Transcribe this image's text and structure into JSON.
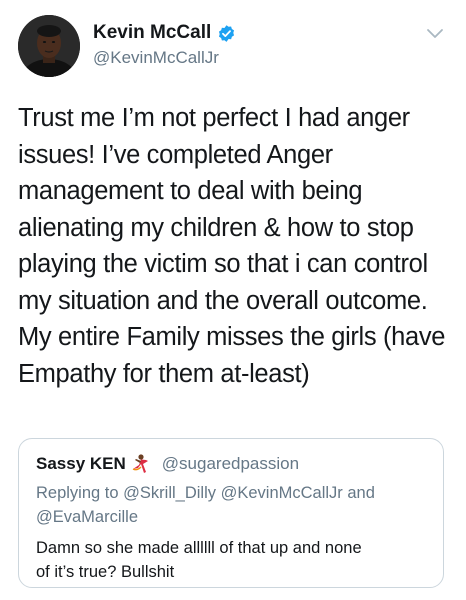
{
  "author": {
    "name": "Kevin McCall",
    "handle": "@KevinMcCallJr",
    "verified": true
  },
  "tweet": {
    "lines": [
      "Trust me I’m not perfect I had anger",
      "issues! I’ve completed Anger",
      "management to deal with being",
      "alienating my children & how to stop",
      "playing the victim so that i can control",
      "my situation and the overall outcome.",
      "My entire Family misses the girls (have",
      "Empathy for them at-least)"
    ]
  },
  "quoted": {
    "name": "Sassy KEN",
    "emoji": "dancer-emoji",
    "handle": "@sugaredpassion",
    "replying_prefix": "Replying to",
    "reply_users": [
      "@Skrill_Dilly",
      "@KevinMcCallJr",
      "@EvaMarcille"
    ],
    "reply_and": "and",
    "body_lines": [
      "Damn so she made allllll of that up and none",
      "of it’s true? Bullshit"
    ]
  },
  "icons": {
    "verified": "verified-badge-icon",
    "menu": "chevron-down-icon"
  },
  "colors": {
    "verified": "#1da1f2",
    "secondary_text": "#657786",
    "card_border": "#ccd6dd"
  }
}
